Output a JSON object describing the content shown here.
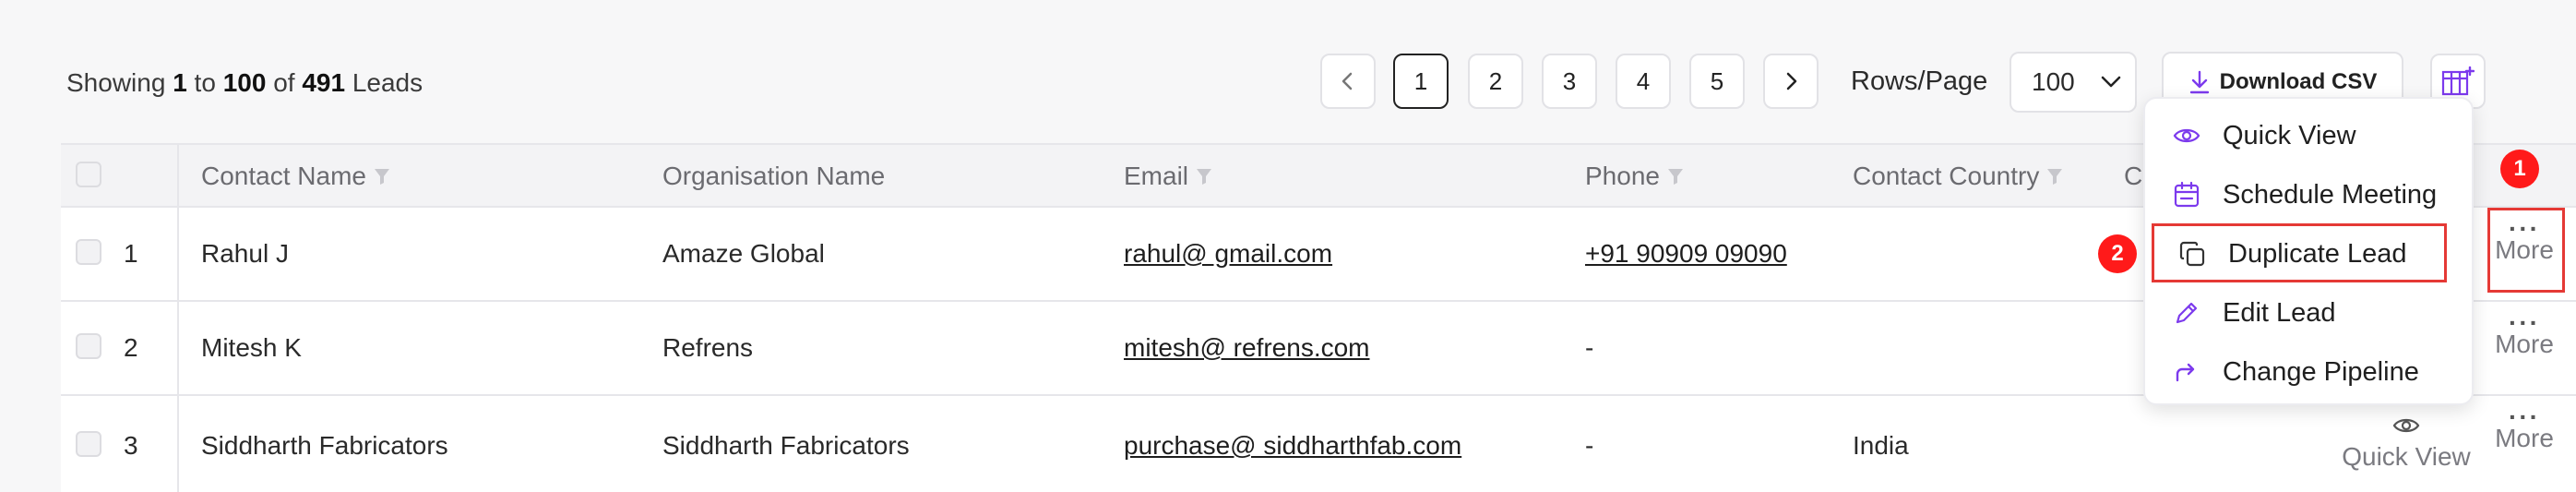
{
  "summary": {
    "prefix": "Showing",
    "from": "1",
    "to_word": "to",
    "to": "100",
    "of_word": "of",
    "total": "491",
    "noun": "Leads"
  },
  "pagination": {
    "pages": [
      "1",
      "2",
      "3",
      "4",
      "5"
    ],
    "active": "1"
  },
  "rows_per_page": {
    "label": "Rows/Page",
    "value": "100"
  },
  "toolbar": {
    "download_label": "Download CSV"
  },
  "table": {
    "headers": {
      "contact_name": "Contact Name",
      "organisation": "Organisation Name",
      "email": "Email",
      "phone": "Phone",
      "country": "Contact Country",
      "partial": "C"
    },
    "rows": [
      {
        "num": "1",
        "contact_name": "Rahul J",
        "organisation": "Amaze Global",
        "email": "rahul@ gmail.com",
        "phone": "+91 90909 09090",
        "country": "",
        "more": "More"
      },
      {
        "num": "2",
        "contact_name": "Mitesh K",
        "organisation": "Refrens",
        "email": "mitesh@ refrens.com",
        "phone": "-",
        "country": "",
        "more": "More"
      },
      {
        "num": "3",
        "contact_name": "Siddharth Fabricators",
        "organisation": "Siddharth Fabricators",
        "email": "purchase@ siddharthfab.com",
        "phone": "-",
        "country": "India",
        "quick_view": "Quick View",
        "more": "More"
      }
    ]
  },
  "menu": {
    "items": [
      "Quick View",
      "Schedule Meeting",
      "Duplicate Lead",
      "Edit Lead",
      "Change Pipeline"
    ]
  },
  "annotations": {
    "badge1": "1",
    "badge2": "2"
  },
  "colors": {
    "accent": "#7c3aed",
    "highlight": "#e53935",
    "badge": "#ff1a1a"
  }
}
